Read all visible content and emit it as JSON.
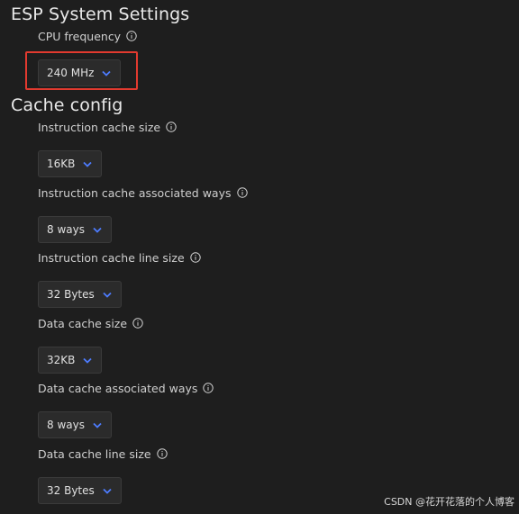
{
  "sections": {
    "esp_title": "ESP System Settings",
    "cache_title": "Cache config"
  },
  "cpu_frequency": {
    "label": "CPU frequency",
    "value": "240 MHz"
  },
  "instruction_cache_size": {
    "label": "Instruction cache size",
    "value": "16KB"
  },
  "instruction_cache_ways": {
    "label": "Instruction cache associated ways",
    "value": "8 ways"
  },
  "instruction_cache_line": {
    "label": "Instruction cache line size",
    "value": "32 Bytes"
  },
  "data_cache_size": {
    "label": "Data cache size",
    "value": "32KB"
  },
  "data_cache_ways": {
    "label": "Data cache associated ways",
    "value": "8 ways"
  },
  "data_cache_line": {
    "label": "Data cache line size",
    "value": "32 Bytes"
  },
  "watermark": "CSDN @花开花落的个人博客",
  "colors": {
    "background": "#1e1e1e",
    "chevron": "#4d7cff",
    "highlight": "#e23a2f"
  },
  "icons": {
    "info": "info-icon",
    "chevron": "chevron-down-icon"
  }
}
